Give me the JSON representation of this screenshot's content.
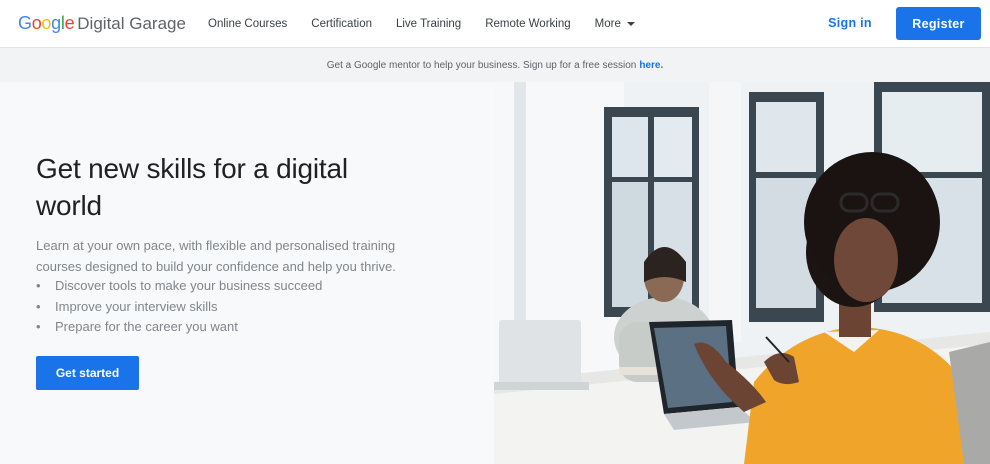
{
  "brand": {
    "google_letters": [
      {
        "char": "G",
        "color": "#4285F4"
      },
      {
        "char": "o",
        "color": "#EA4335"
      },
      {
        "char": "o",
        "color": "#FBBC05"
      },
      {
        "char": "g",
        "color": "#4285F4"
      },
      {
        "char": "l",
        "color": "#34A853"
      },
      {
        "char": "e",
        "color": "#EA4335"
      }
    ],
    "product": "Digital Garage"
  },
  "nav": {
    "items": [
      {
        "label": "Online Courses"
      },
      {
        "label": "Certification"
      },
      {
        "label": "Live Training"
      },
      {
        "label": "Remote Working"
      },
      {
        "label": "More"
      }
    ],
    "sign_in": "Sign in",
    "register": "Register"
  },
  "banner": {
    "text": "Get a Google mentor to help your business. Sign up for a free session",
    "link": "here."
  },
  "hero": {
    "title": "Get new skills for a digital world",
    "description": "Learn at your own pace, with flexible and personalised training courses designed to build your confidence and help you thrive.",
    "bullets": [
      {
        "dot": "•",
        "text": "Discover tools to make your business succeed"
      },
      {
        "dot": "•",
        "text": "Improve your interview skills"
      },
      {
        "dot": "•",
        "text": "Prepare for the career you want"
      }
    ],
    "cta": "Get started"
  },
  "colors": {
    "accent": "#1a73e8",
    "banner_bg": "#f1f3f4",
    "hero_bg": "#f8f9fa"
  }
}
